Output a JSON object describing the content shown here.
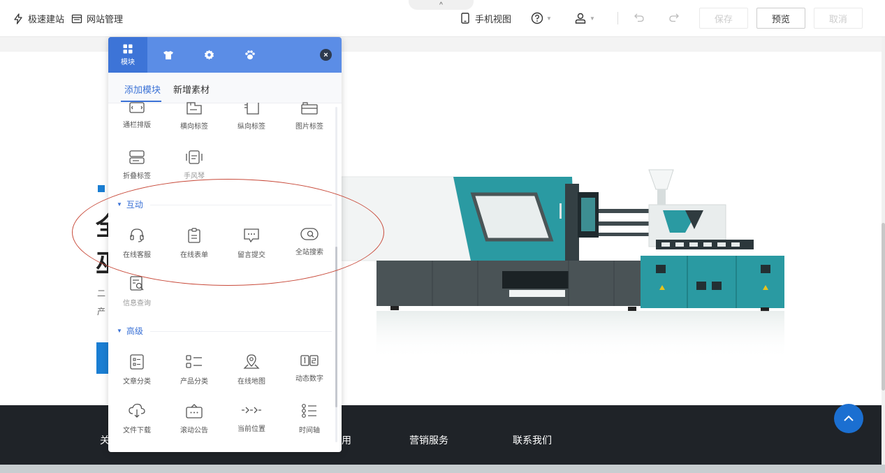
{
  "topbar": {
    "quick_build": "极速建站",
    "site_manage": "网站管理",
    "mobile_view": "手机视图",
    "save": "保存",
    "preview": "预览",
    "cancel": "取消",
    "collapse_glyph": "^"
  },
  "canvas": {
    "heading_char1": "全",
    "heading_char2": "巫",
    "text_char1": "二",
    "text_char2": "产"
  },
  "panel": {
    "tabs": [
      {
        "icon": "grid-icon",
        "label": "模块"
      },
      {
        "icon": "shirt-icon",
        "label": ""
      },
      {
        "icon": "gear-icon",
        "label": ""
      },
      {
        "icon": "paw-icon",
        "label": ""
      }
    ],
    "close": "×",
    "subtabs": [
      "添加模块",
      "新增素材"
    ],
    "row1": [
      "通栏排版",
      "横向标签",
      "纵向标签",
      "图片标签"
    ],
    "row2": [
      "折叠标签",
      "手风琴"
    ],
    "section_interactive": "互动",
    "interactive": [
      "在线客服",
      "在线表单",
      "留言提交",
      "全站搜索"
    ],
    "interactive2": [
      "信息查询"
    ],
    "section_advanced": "高级",
    "advanced": [
      "文章分类",
      "产品分类",
      "在线地图",
      "动态数字"
    ],
    "advanced2": [
      "文件下载",
      "滚动公告",
      "当前位置",
      "时间轴"
    ]
  },
  "footer": {
    "nav_partial_left": "关",
    "nav_partial_mid": "用",
    "nav_marketing": "营销服务",
    "nav_contact": "联系我们"
  },
  "colors": {
    "accent": "#3b72d6",
    "panel_header": "#5b8de6",
    "footer_bg": "#1f2328",
    "annotation": "#c84a3a"
  }
}
